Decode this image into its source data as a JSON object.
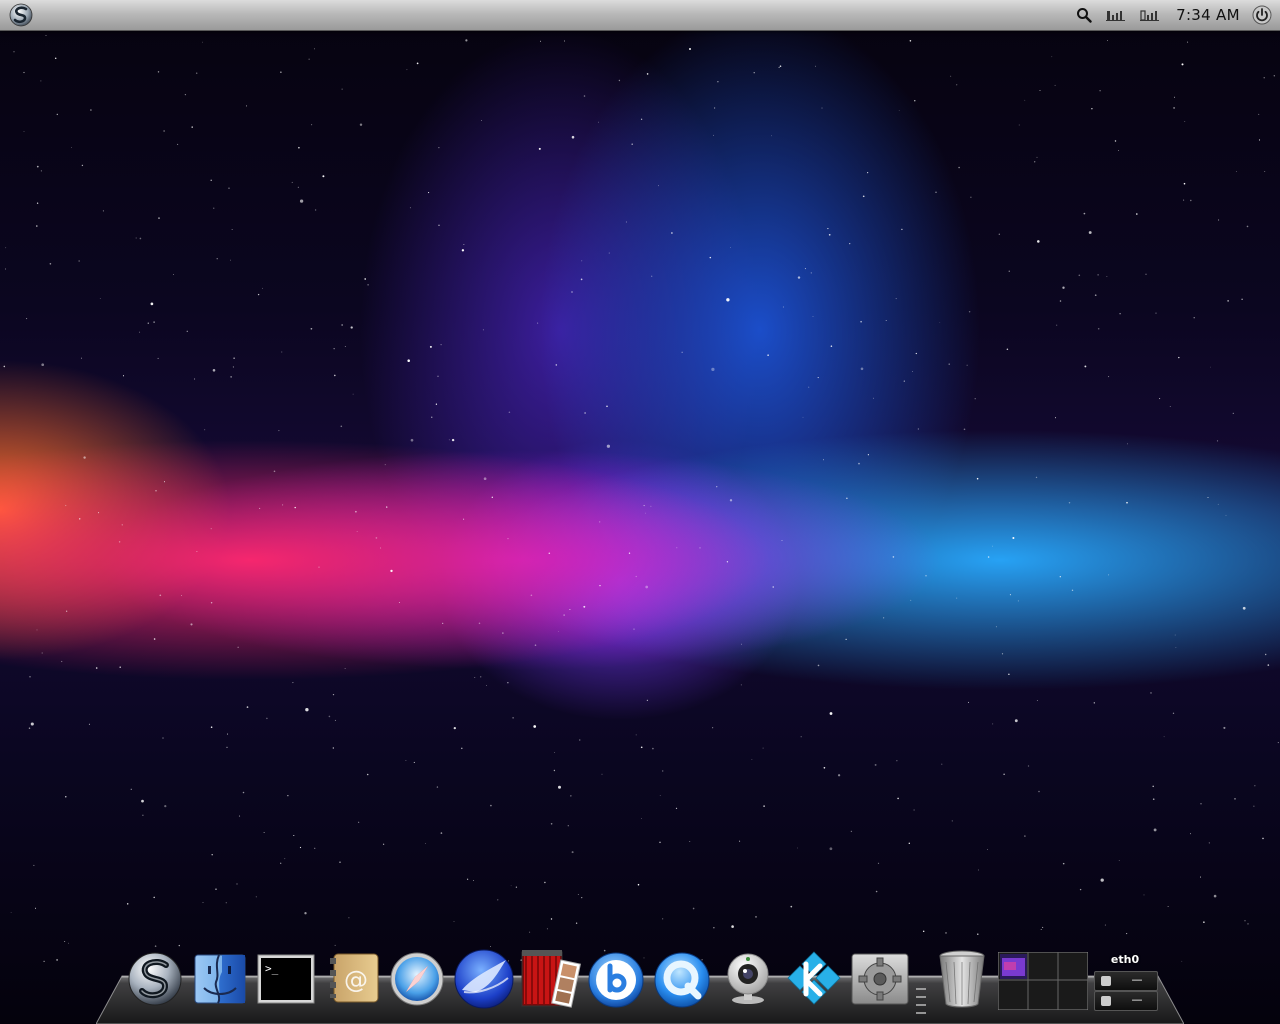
{
  "topbar": {
    "clock": "7:34 AM",
    "logo_icon": "s-logo-icon",
    "search_icon": "search-icon",
    "signal_icons": [
      "network-signal-icon",
      "battery-signal-icon"
    ],
    "power_icon": "power-icon"
  },
  "dock": {
    "apps": [
      {
        "icon": "s-logo-app-icon"
      },
      {
        "icon": "finder-icon"
      },
      {
        "icon": "terminal-icon"
      },
      {
        "icon": "address-book-icon"
      },
      {
        "icon": "safari-compass-icon"
      },
      {
        "icon": "seamonkey-icon"
      },
      {
        "icon": "photo-booth-icon"
      },
      {
        "icon": "beryl-b-icon"
      },
      {
        "icon": "quicktime-icon"
      },
      {
        "icon": "webcam-icon"
      },
      {
        "icon": "kodi-icon"
      },
      {
        "icon": "system-preferences-icon"
      },
      {
        "icon": "trash-icon"
      },
      {
        "icon": "workspace-switcher-icon"
      }
    ],
    "network_monitor": {
      "interface": "eth0",
      "rx": "—",
      "tx": "—"
    }
  },
  "colors": {
    "topbar_light": "#dcdcdc",
    "topbar_dark": "#9a9a9a",
    "wallpaper_pink": "#ff2870",
    "wallpaper_blue": "#28aaff",
    "wallpaper_purple": "#be1ef0"
  }
}
